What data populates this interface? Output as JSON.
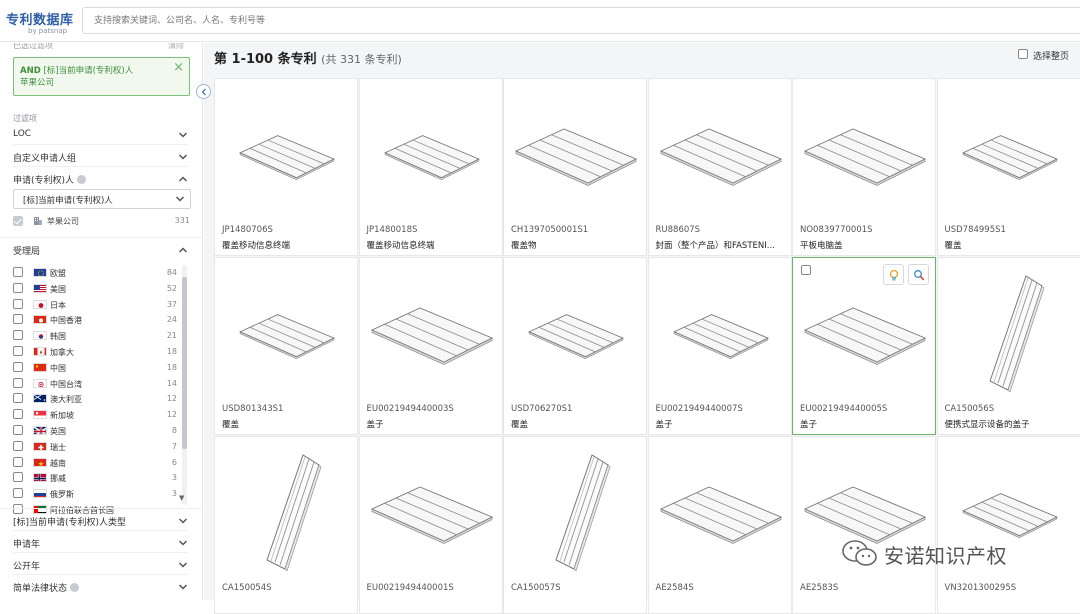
{
  "header": {
    "logo_title": "专利数据库",
    "logo_sub": "by patsnap",
    "search_placeholder": "支持搜索关键词、公司名、人名、专利号等"
  },
  "sidebar": {
    "clip_label": "已选过滤项",
    "clip_right": "清除",
    "applied_filter": {
      "prefix": "AND",
      "field": "[标]当前申请(专利权)人",
      "value": "苹果公司"
    },
    "filters_label": "过滤项",
    "facets_top": [
      {
        "label": "LOC"
      },
      {
        "label": "自定义申请人组"
      },
      {
        "label": "申请(专利权)人"
      }
    ],
    "owner_select_value": "[标]当前申请(专利权)人",
    "owner_item": {
      "name": "苹果公司",
      "count": "331"
    },
    "office_title": "受理局",
    "offices": [
      {
        "name": "欧盟",
        "count": "84",
        "flag": "eu"
      },
      {
        "name": "美国",
        "count": "52",
        "flag": "us"
      },
      {
        "name": "日本",
        "count": "37",
        "flag": "jp"
      },
      {
        "name": "中国香港",
        "count": "24",
        "flag": "hk"
      },
      {
        "name": "韩国",
        "count": "21",
        "flag": "kr"
      },
      {
        "name": "加拿大",
        "count": "18",
        "flag": "ca"
      },
      {
        "name": "中国",
        "count": "18",
        "flag": "cn"
      },
      {
        "name": "中国台湾",
        "count": "14",
        "flag": "tw"
      },
      {
        "name": "澳大利亚",
        "count": "12",
        "flag": "au"
      },
      {
        "name": "新加坡",
        "count": "12",
        "flag": "sg"
      },
      {
        "name": "英国",
        "count": "8",
        "flag": "gb"
      },
      {
        "name": "瑞士",
        "count": "7",
        "flag": "ch"
      },
      {
        "name": "越南",
        "count": "6",
        "flag": "vn"
      },
      {
        "name": "挪威",
        "count": "3",
        "flag": "no"
      },
      {
        "name": "俄罗斯",
        "count": "3",
        "flag": "ru"
      },
      {
        "name": "阿拉伯联合酋长国",
        "count": "",
        "flag": "ae"
      }
    ],
    "facets_bottom": [
      {
        "label": "[标]当前申请(专利权)人类型"
      },
      {
        "label": "申请年"
      },
      {
        "label": "公开年"
      },
      {
        "label": "简单法律状态"
      }
    ]
  },
  "main": {
    "heading": "第 1-100 条专利",
    "heading_total": "(共 331 条专利)",
    "select_page": "选择整页",
    "cards": [
      {
        "number": "JP1480706S",
        "title": "覆盖移动信息终端",
        "shape": "flat-sm"
      },
      {
        "number": "JP1480018S",
        "title": "覆盖移动信息终端",
        "shape": "flat-sm"
      },
      {
        "number": "CH1397050001S1",
        "title": "覆盖物",
        "shape": "flat-lg"
      },
      {
        "number": "RU88607S",
        "title": "封面（整个产品）和FASTENI...",
        "shape": "flat-lg"
      },
      {
        "number": "NO0839770001S",
        "title": "平板电脑盖",
        "shape": "flat-lg"
      },
      {
        "number": "USD784995S1",
        "title": "覆盖",
        "shape": "flat-sm"
      },
      {
        "number": "USD801343S1",
        "title": "覆盖",
        "shape": "flat-sm"
      },
      {
        "number": "EU0021949440003S",
        "title": "盖子",
        "shape": "flat-lg"
      },
      {
        "number": "USD706270S1",
        "title": "覆盖",
        "shape": "flat-sm"
      },
      {
        "number": "EU0021949440007S",
        "title": "盖子",
        "shape": "flat-sm"
      },
      {
        "number": "EU0021949440005S",
        "title": "盖子",
        "shape": "flat-lg",
        "selected": true
      },
      {
        "number": "CA150056S",
        "title": "便携式显示设备的盖子",
        "shape": "tall"
      },
      {
        "number": "CA150054S",
        "title": "",
        "shape": "tall"
      },
      {
        "number": "EU0021949440001S",
        "title": "",
        "shape": "flat-lg"
      },
      {
        "number": "CA150057S",
        "title": "",
        "shape": "tall"
      },
      {
        "number": "AE2584S",
        "title": "",
        "shape": "flat-lg"
      },
      {
        "number": "AE2583S",
        "title": "",
        "shape": "flat-lg"
      },
      {
        "number": "VN3201300295S",
        "title": "",
        "shape": "flat-sm"
      }
    ]
  },
  "watermark": "安诺知识产权",
  "colors": {
    "accent_green": "#6cb36a",
    "brand_blue": "#2f5fa7"
  }
}
